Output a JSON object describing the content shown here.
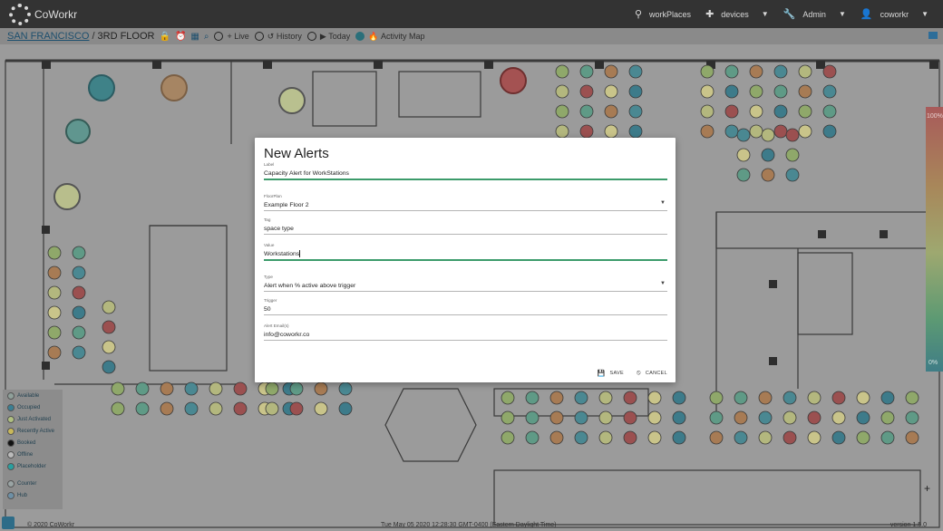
{
  "app": {
    "name": "CoWorkr"
  },
  "nav": [
    {
      "icon": "pin-icon",
      "glyph": "⚲",
      "label": "workPlaces"
    },
    {
      "icon": "puzzle-icon",
      "glyph": "✚",
      "label": "devices",
      "caret": "▼"
    },
    {
      "icon": "wrench-icon",
      "glyph": "🔧",
      "label": "Admin",
      "caret": "▼"
    },
    {
      "icon": "user-icon",
      "glyph": "👤",
      "label": "coworkr",
      "caret": "▼"
    }
  ],
  "breadcrumb": {
    "city": "SAN FRANCISCO",
    "sep": "/",
    "floor": "3RD FLOOR"
  },
  "view_options": [
    {
      "label": "Live",
      "glyph": "+",
      "selected": false
    },
    {
      "label": "History",
      "glyph": "↺",
      "selected": false
    },
    {
      "label": "Today",
      "glyph": "▶",
      "selected": false
    },
    {
      "label": "Activity Map",
      "glyph": "🔥",
      "selected": true
    }
  ],
  "legend": [
    {
      "label": "Available",
      "color": "#8fa09a"
    },
    {
      "label": "Occupied",
      "color": "#3a7f93"
    },
    {
      "label": "Just Activated",
      "color": "#b0c080"
    },
    {
      "label": "Recently Active",
      "color": "#c9b85a"
    },
    {
      "label": "Booked",
      "color": "#111111"
    },
    {
      "label": "Offline",
      "color": "#bbbbbb"
    },
    {
      "label": "Placeholder",
      "color": "#2aa0a0"
    },
    {
      "label": "Counter",
      "color": "#9aa4a4"
    },
    {
      "label": "Hub",
      "color": "#6e90a6"
    }
  ],
  "scale": {
    "top": "100%",
    "bottom": "0%"
  },
  "footer": {
    "copyright": "© 2020 CoWorkr",
    "timestamp": "Tue May 05 2020 12:28:30 GMT-0400 (Eastern Daylight Time)",
    "version": "version 1.5.0"
  },
  "modal": {
    "title": "New Alerts",
    "fields": [
      {
        "label": "Label",
        "value": "Capacity Alert for WorkStations"
      },
      {
        "label": "FloorPlan",
        "value": "Example Floor 2",
        "caret": "▼"
      },
      {
        "label": "Tag",
        "value": "space type"
      },
      {
        "label": "Value",
        "value": "Workstations"
      },
      {
        "label": "Type",
        "value": "Alert when % active above trigger",
        "caret": "▼"
      },
      {
        "label": "Trigger",
        "value": "50"
      },
      {
        "label": "Alert Email(s)",
        "value": "info@coworkr.co"
      }
    ],
    "save": {
      "glyph": "💾",
      "label": "SAVE"
    },
    "cancel": {
      "glyph": "⦸",
      "label": "CANCEL"
    }
  },
  "colors": {
    "accent": "#3c9b6b",
    "topbar": "#333333",
    "occupied": "#3a7f93"
  }
}
